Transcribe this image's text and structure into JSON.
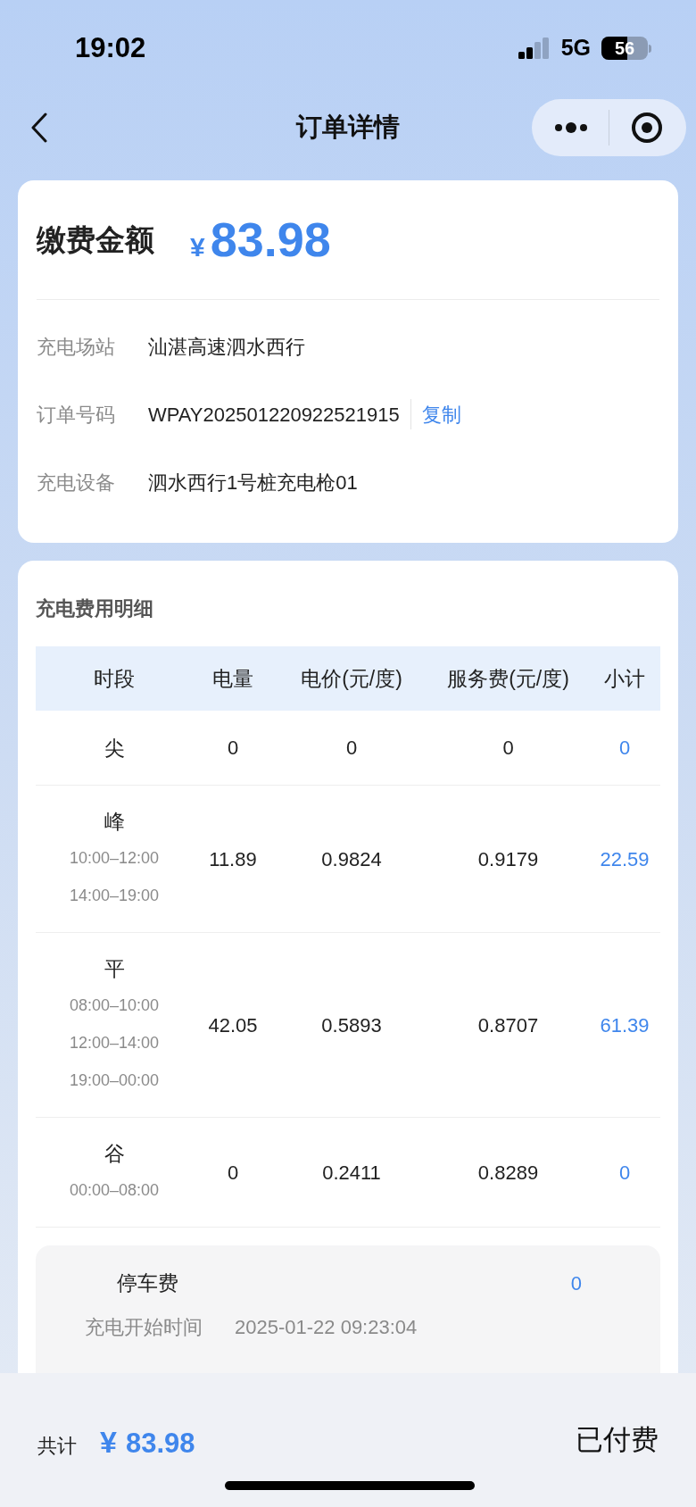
{
  "status_bar": {
    "time": "19:02",
    "network": "5G",
    "battery": "56"
  },
  "nav_bar": {
    "title": "订单详情"
  },
  "summary": {
    "label": "缴费金额",
    "currency": "¥",
    "amount": "83.98",
    "fields": [
      {
        "label": "充电场站",
        "value": "汕湛高速泗水西行"
      },
      {
        "label": "订单号码",
        "value": "WPAY202501220922521915",
        "action": "复制"
      },
      {
        "label": "充电设备",
        "value": "泗水西行1号桩充电枪01"
      }
    ]
  },
  "details": {
    "title": "充电费用明细",
    "columns": [
      "时段",
      "电量",
      "电价(元/度)",
      "服务费(元/度)",
      "小计"
    ],
    "rows": [
      {
        "period": "尖",
        "times": [],
        "energy": "0",
        "price": "0",
        "service": "0",
        "subtotal": "0"
      },
      {
        "period": "峰",
        "times": [
          "10:00–12:00",
          "14:00–19:00"
        ],
        "energy": "11.89",
        "price": "0.9824",
        "service": "0.9179",
        "subtotal": "22.59"
      },
      {
        "period": "平",
        "times": [
          "08:00–10:00",
          "12:00–14:00",
          "19:00–00:00"
        ],
        "energy": "42.05",
        "price": "0.5893",
        "service": "0.8707",
        "subtotal": "61.39"
      },
      {
        "period": "谷",
        "times": [
          "00:00–08:00"
        ],
        "energy": "0",
        "price": "0.2411",
        "service": "0.8289",
        "subtotal": "0"
      }
    ],
    "parking": {
      "label": "停车费",
      "value": "0"
    },
    "start_time": {
      "label": "充电开始时间",
      "value": "2025-01-22 09:23:04"
    }
  },
  "footer": {
    "label": "共计",
    "currency": "¥",
    "amount": "83.98",
    "status": "已付费"
  }
}
